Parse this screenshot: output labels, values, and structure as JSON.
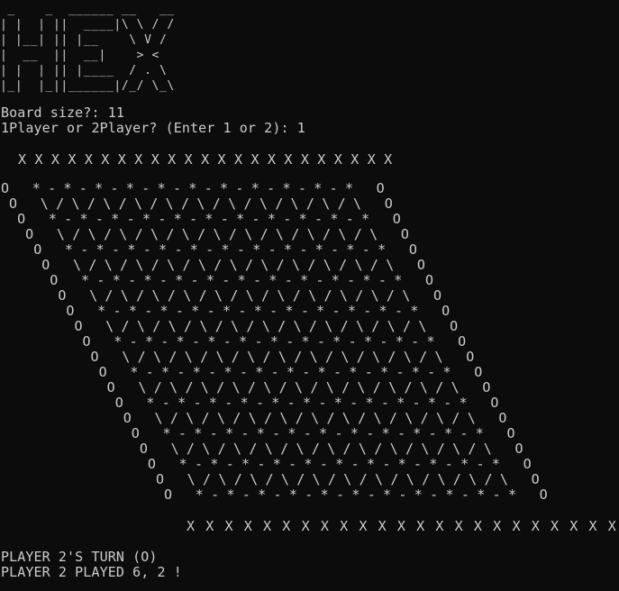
{
  "window": {
    "background": "#0c0c0c",
    "text_color": "#cccccc"
  },
  "logo": {
    "art": " _    _  ______ __   __\n| |  | ||  ____|\\ \\ / /\n| |__| || |__    \\ V / \n|  __  ||  __|    > <  \n| |  | || |____  / . \\ \n|_|  |_||______|/_/ \\_\\"
  },
  "prompts": {
    "board_size": "Board size?: 11",
    "players": "1Player or 2Player? (Enter 1 or 2): 1"
  },
  "board": {
    "top_border": "X X X X X X X X X X X X X X X X X X X X X X X",
    "rows": [
      "O   * - * - * - * - * - * - * - * - * - * - *   O",
      "O   \\ / \\ / \\ / \\ / \\ / \\ / \\ / \\ / \\ / \\ / \\   O",
      "O   * - * - * - * - * - * - * - * - * - * - *   O",
      "O   \\ / \\ / \\ / \\ / \\ / \\ / \\ / \\ / \\ / \\ / \\   O",
      "O   * - * - * - * - * - * - * - * - * - * - *   O",
      "O   \\ / \\ / \\ / \\ / \\ / \\ / \\ / \\ / \\ / \\ / \\   O",
      "O   * - * - * - * - * - * - * - * - * - * - *   O",
      "O   \\ / \\ / \\ / \\ / \\ / \\ / \\ / \\ / \\ / \\ / \\   O",
      "O   * - * - * - * - * - * - * - * - * - * - *   O",
      "O   \\ / \\ / \\ / \\ / \\ / \\ / \\ / \\ / \\ / \\ / \\   O",
      "O   * - * - * - * - * - * - * - * - * - * - *   O",
      "O   \\ / \\ / \\ / \\ / \\ / \\ / \\ / \\ / \\ / \\ / \\   O",
      "O   * - * - * - * - * - * - * - * - * - * - *   O",
      "O   \\ / \\ / \\ / \\ / \\ / \\ / \\ / \\ / \\ / \\ / \\   O",
      "O   * - * - * - * - * - * - * - * - * - * - *   O",
      "O   \\ / \\ / \\ / \\ / \\ / \\ / \\ / \\ / \\ / \\ / \\   O",
      "O   * - * - * - * - * - * - * - * - * - * - *   O",
      "O   \\ / \\ / \\ / \\ / \\ / \\ / \\ / \\ / \\ / \\ / \\   O",
      "O   * - * - * - * - * - * - * - * - * - * - *   O",
      "O   \\ / \\ / \\ / \\ / \\ / \\ / \\ / \\ / \\ / \\ / \\   O",
      "O   * - * - * - * - * - * - * - * - * - * - *   O"
    ],
    "bottom_border": "X X X X X X X X X X X X X X X X X X X X X X X"
  },
  "status": {
    "turn": "PLAYER 2'S TURN (O)",
    "played": "PLAYER 2 PLAYED 6, 2 !"
  }
}
